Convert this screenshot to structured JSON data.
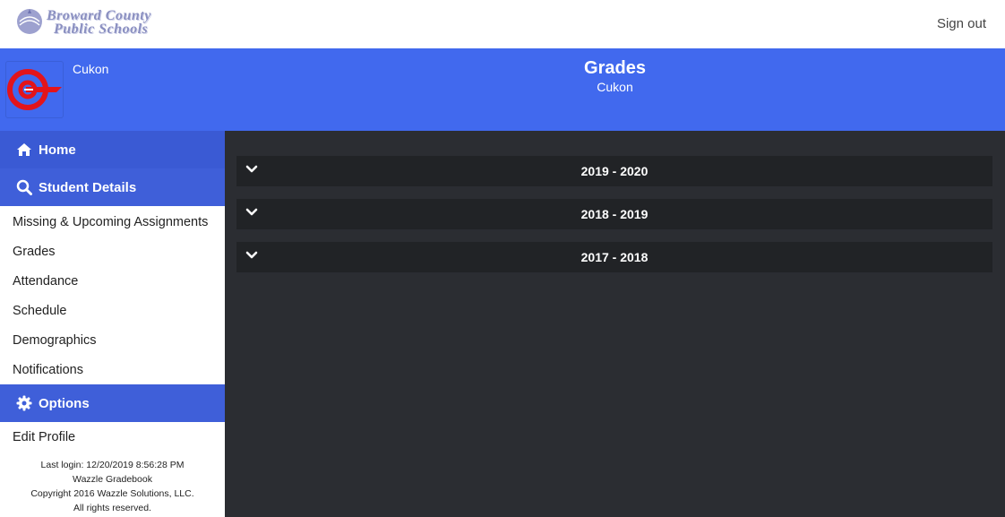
{
  "header": {
    "logo_line1": "Broward County",
    "logo_line2": "Public Schools",
    "signout_label": "Sign out"
  },
  "banner": {
    "student_name": "Cukon",
    "title": "Grades",
    "subtitle": "Cukon"
  },
  "sidebar": {
    "home_label": "Home",
    "student_details_label": "Student Details",
    "links": [
      "Missing & Upcoming Assignments",
      "Grades",
      "Attendance",
      "Schedule",
      "Demographics",
      "Notifications"
    ],
    "options_label": "Options",
    "edit_profile_label": "Edit Profile",
    "footer": {
      "last_login": "Last login: 12/20/2019 8:56:28 PM",
      "product": "Wazzle Gradebook",
      "copyright": "Copyright 2016 Wazzle Solutions, LLC.",
      "rights": "All rights reserved."
    }
  },
  "main": {
    "years": [
      "2019 - 2020",
      "2018 - 2019",
      "2017 - 2018"
    ]
  },
  "colors": {
    "banner_blue": "#4169ee",
    "nav_blue": "#3f5fd9",
    "panel_dark": "#2b2d32",
    "row_dark": "#212326"
  },
  "icons": {
    "home": "home-icon",
    "student_details": "search-icon",
    "options": "gear-icon",
    "expand": "chevron-down-icon",
    "avatar": "school-logo-icon"
  }
}
